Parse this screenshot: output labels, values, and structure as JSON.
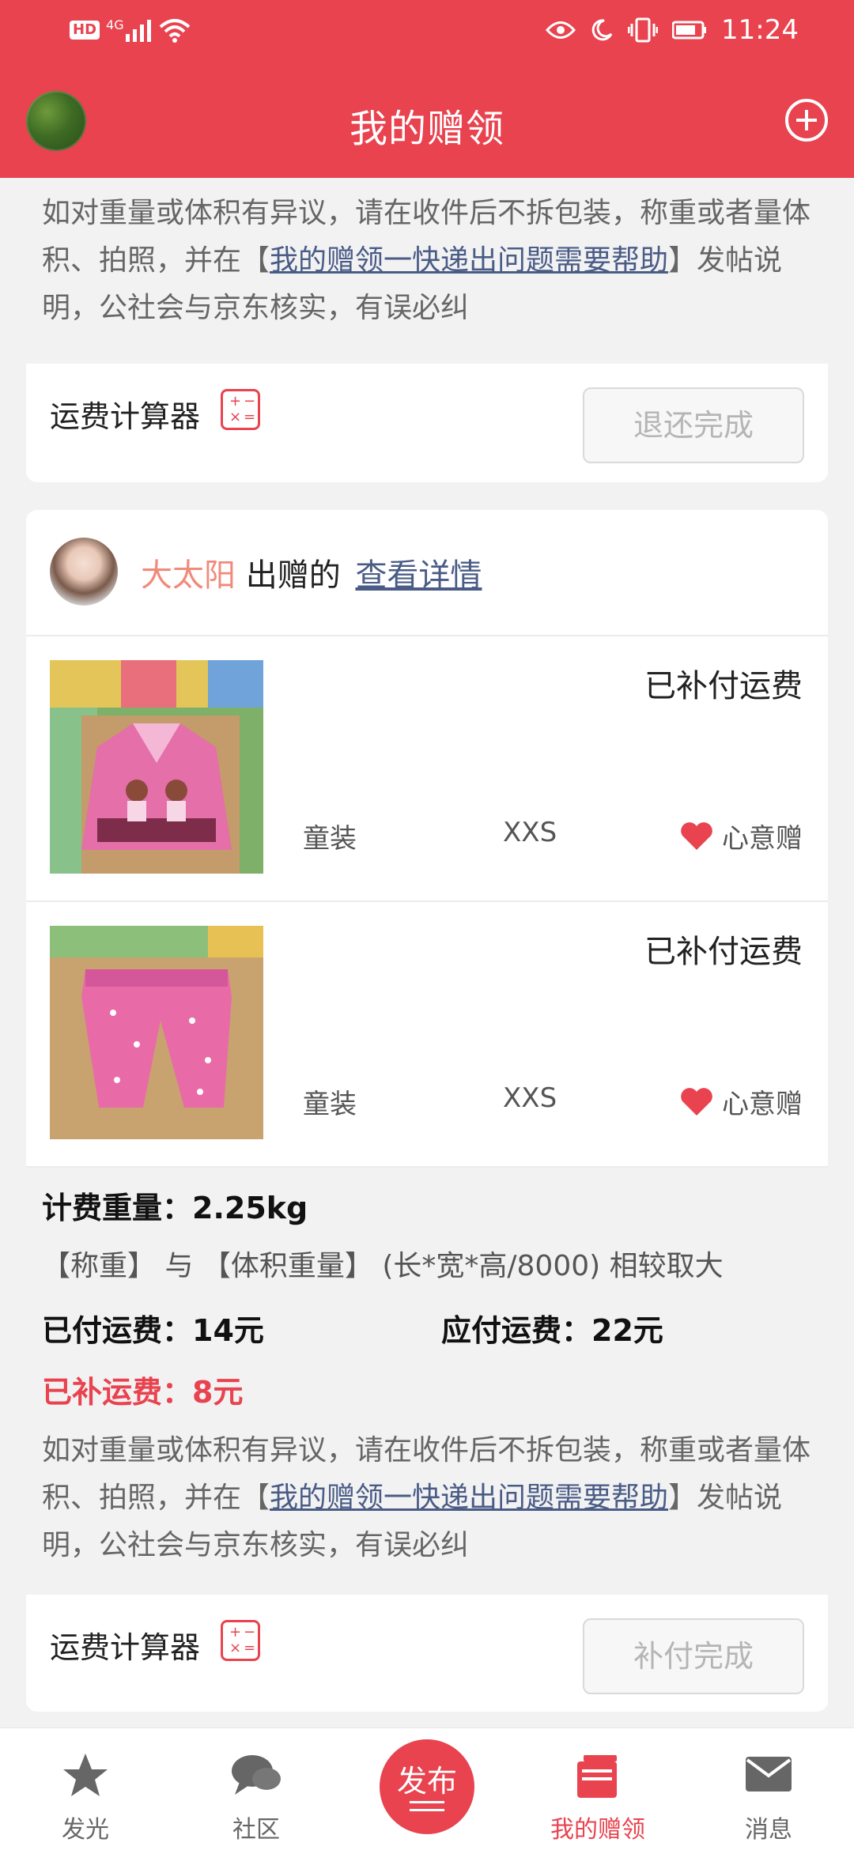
{
  "status_bar": {
    "left_badge": "HD",
    "network": "4G",
    "time": "11:24"
  },
  "header": {
    "title": "我的赠领"
  },
  "card1": {
    "note": {
      "part1": "如对重量或体积有异议，请在收件后不拆包装，称重或者量体积、拍照，并在【",
      "link": "我的赠领一快递出问题需要帮助",
      "part2": "】发帖说明，公社会与京东核实，有误必纠"
    },
    "calc_label": "运费计算器",
    "action_label": "退还完成"
  },
  "card2": {
    "donor_name": "大太阳",
    "donor_suffix": "出赠的",
    "detail_link": "查看详情",
    "items": [
      {
        "status": "已补付运费",
        "category": "童装",
        "size": "XXS",
        "type": "心意赠",
        "image": "pink-girls-jacket"
      },
      {
        "status": "已补付运费",
        "category": "童装",
        "size": "XXS",
        "type": "心意赠",
        "image": "pink-quilted-pants"
      }
    ],
    "fee": {
      "weight": "计费重量：2.25kg",
      "rule": "【称重】 与 【体积重量】 (长*宽*高/8000) 相较取大",
      "paid": "已付运费：14元",
      "due": "应付运费：22元",
      "extra": "已补运费：8元"
    },
    "note": {
      "part1": "如对重量或体积有异议，请在收件后不拆包装，称重或者量体积、拍照，并在【",
      "link": "我的赠领一快递出问题需要帮助",
      "part2": "】发帖说明，公社会与京东核实，有误必纠"
    },
    "calc_label": "运费计算器",
    "action_label": "补付完成"
  },
  "bottom_nav": {
    "items": [
      {
        "label": "发光",
        "icon": "star-icon"
      },
      {
        "label": "社区",
        "icon": "chat-bubbles-icon"
      },
      {
        "label": "发布",
        "icon": "publish-icon"
      },
      {
        "label": "我的赠领",
        "icon": "gift-book-icon"
      },
      {
        "label": "消息",
        "icon": "mail-icon"
      }
    ],
    "active_index": 3
  },
  "colors": {
    "brand_red": "#e8434f",
    "link_blue": "#4a5c86",
    "donor_name": "#f08a7a"
  }
}
